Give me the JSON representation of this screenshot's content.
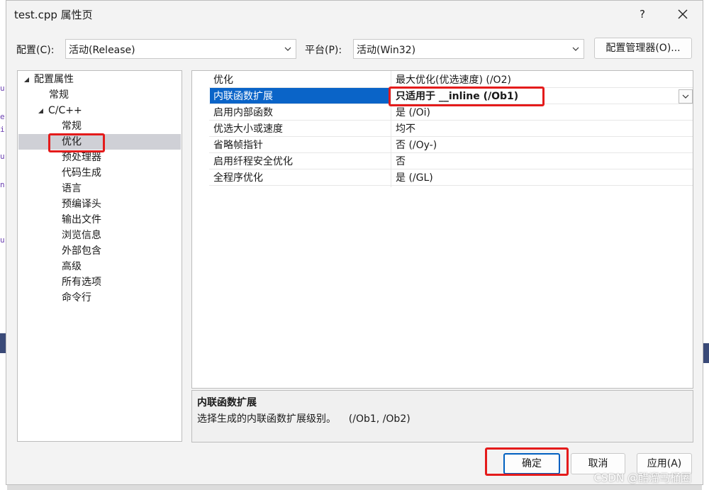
{
  "window": {
    "title": "test.cpp 属性页",
    "help_label": "?"
  },
  "toolbar": {
    "config_label": "配置(C):",
    "config_value": "活动(Release)",
    "platform_label": "平台(P):",
    "platform_value": "活动(Win32)",
    "manager_label": "配置管理器(O)..."
  },
  "tree": {
    "root": "配置属性",
    "general": "常规",
    "cpp": "C/C++",
    "children": [
      "常规",
      "优化",
      "预处理器",
      "代码生成",
      "语言",
      "预编译头",
      "输出文件",
      "浏览信息",
      "外部包含",
      "高级",
      "所有选项",
      "命令行"
    ],
    "selected": "优化"
  },
  "grid": {
    "rows": [
      {
        "name": "优化",
        "value": "最大优化(优选速度) (/O2)"
      },
      {
        "name": "内联函数扩展",
        "value": "只适用于 __inline (/Ob1)"
      },
      {
        "name": "启用内部函数",
        "value": "是 (/Oi)"
      },
      {
        "name": "优选大小或速度",
        "value": "均不"
      },
      {
        "name": "省略帧指针",
        "value": "否 (/Oy-)"
      },
      {
        "name": "启用纤程安全优化",
        "value": "否"
      },
      {
        "name": "全程序优化",
        "value": "是 (/GL)"
      }
    ],
    "selected_index": 1
  },
  "description": {
    "title": "内联函数扩展",
    "text": "选择生成的内联函数扩展级别。    (/Ob1, /Ob2)"
  },
  "buttons": {
    "ok": "确定",
    "cancel": "取消",
    "apply": "应用(A)"
  },
  "watermark": "CSDN @醋溜马桶圈",
  "colors": {
    "selection": "#0a64c8",
    "highlight": "#e41b1b",
    "tree_selection": "#cfd0d6"
  }
}
